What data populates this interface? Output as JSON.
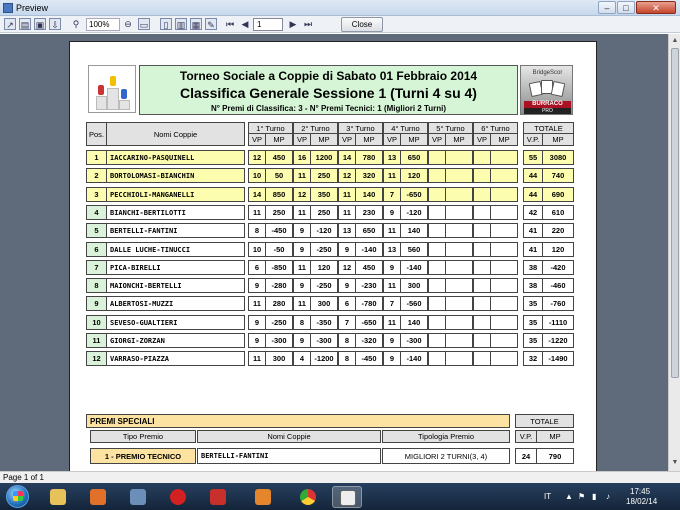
{
  "window": {
    "title": "Preview",
    "minimize": "–",
    "maximize": "□",
    "close": "✕"
  },
  "toolbar": {
    "zoom": "100%",
    "page": "1",
    "close_label": "Close"
  },
  "status": {
    "page_info": "Page 1 of 1"
  },
  "tray": {
    "lang": "IT",
    "time": "17:45",
    "date": "18/02/14"
  },
  "report": {
    "title": "Torneo Sociale a Coppie di Sabato 01 Febbraio 2014",
    "subtitle": "Classifica Generale Sessione 1 (Turni 4 su 4)",
    "info": "N° Premi di Classifica: 3  -  N° Premi Tecnici: 1 (Migliori 2 Turni)",
    "logo_brand": "BURRACO",
    "logo_sub": "PRO",
    "logo_top": "BridgeScor",
    "col_pos": "Pos.",
    "col_names": "Nomi Coppie",
    "turns": [
      "1° Turno",
      "2° Turno",
      "3° Turno",
      "4° Turno",
      "5° Turno",
      "6° Turno"
    ],
    "col_totale": "TOTALE",
    "sub_vp": "VP",
    "sub_mp": "MP",
    "sub_tvp": "V.P.",
    "sub_tmp": "MP",
    "rows": [
      {
        "pos": "1",
        "name": "IACCARINO-PASQUINELL",
        "t": [
          [
            "12",
            "450"
          ],
          [
            "16",
            "1200"
          ],
          [
            "14",
            "780"
          ],
          [
            "13",
            "650"
          ]
        ],
        "vp": "55",
        "mp": "3080",
        "hl": true
      },
      {
        "pos": "2",
        "name": "BORTOLOMASI-BIANCHIN",
        "t": [
          [
            "10",
            "50"
          ],
          [
            "11",
            "250"
          ],
          [
            "12",
            "320"
          ],
          [
            "11",
            "120"
          ]
        ],
        "vp": "44",
        "mp": "740",
        "hl": true
      },
      {
        "pos": "3",
        "name": "PECCHIOLI-MANGANELLI",
        "t": [
          [
            "14",
            "850"
          ],
          [
            "12",
            "350"
          ],
          [
            "11",
            "140"
          ],
          [
            "7",
            "-650"
          ]
        ],
        "vp": "44",
        "mp": "690",
        "hl": true
      },
      {
        "pos": "4",
        "name": "BIANCHI-BERTILOTTI",
        "t": [
          [
            "11",
            "250"
          ],
          [
            "11",
            "250"
          ],
          [
            "11",
            "230"
          ],
          [
            "9",
            "-120"
          ]
        ],
        "vp": "42",
        "mp": "610",
        "hl": false
      },
      {
        "pos": "5",
        "name": "BERTELLI-FANTINI",
        "t": [
          [
            "8",
            "-450"
          ],
          [
            "9",
            "-120"
          ],
          [
            "13",
            "650"
          ],
          [
            "11",
            "140"
          ]
        ],
        "vp": "41",
        "mp": "220",
        "hl": false
      },
      {
        "pos": "6",
        "name": "DALLE LUCHE-TINUCCI",
        "t": [
          [
            "10",
            "-50"
          ],
          [
            "9",
            "-250"
          ],
          [
            "9",
            "-140"
          ],
          [
            "13",
            "560"
          ]
        ],
        "vp": "41",
        "mp": "120",
        "hl": false
      },
      {
        "pos": "7",
        "name": "PICA-BIRELLI",
        "t": [
          [
            "6",
            "-850"
          ],
          [
            "11",
            "120"
          ],
          [
            "12",
            "450"
          ],
          [
            "9",
            "-140"
          ]
        ],
        "vp": "38",
        "mp": "-420",
        "hl": false
      },
      {
        "pos": "8",
        "name": "MAIONCHI-BERTELLI",
        "t": [
          [
            "9",
            "-280"
          ],
          [
            "9",
            "-250"
          ],
          [
            "9",
            "-230"
          ],
          [
            "11",
            "300"
          ]
        ],
        "vp": "38",
        "mp": "-460",
        "hl": false
      },
      {
        "pos": "9",
        "name": "ALBERTOSI-MUZZI",
        "t": [
          [
            "11",
            "280"
          ],
          [
            "11",
            "300"
          ],
          [
            "6",
            "-780"
          ],
          [
            "7",
            "-560"
          ]
        ],
        "vp": "35",
        "mp": "-760",
        "hl": false
      },
      {
        "pos": "10",
        "name": "SEVESO-GUALTIERI",
        "t": [
          [
            "9",
            "-250"
          ],
          [
            "8",
            "-350"
          ],
          [
            "7",
            "-650"
          ],
          [
            "11",
            "140"
          ]
        ],
        "vp": "35",
        "mp": "-1110",
        "hl": false
      },
      {
        "pos": "11",
        "name": "GIORGI-ZORZAN",
        "t": [
          [
            "9",
            "-300"
          ],
          [
            "9",
            "-300"
          ],
          [
            "8",
            "-320"
          ],
          [
            "9",
            "-300"
          ]
        ],
        "vp": "35",
        "mp": "-1220",
        "hl": false
      },
      {
        "pos": "12",
        "name": "VARRASO-PIAZZA",
        "t": [
          [
            "11",
            "300"
          ],
          [
            "4",
            "-1200"
          ],
          [
            "8",
            "-450"
          ],
          [
            "9",
            "-140"
          ]
        ],
        "vp": "32",
        "mp": "-1490",
        "hl": false
      }
    ],
    "premi": {
      "title": "PREMI SPECIALI",
      "col_tipo": "Tipo Premio",
      "col_nomi": "Nomi Coppie",
      "col_tipologia": "Tipologia Premio",
      "col_totale": "TOTALE",
      "sub_vp": "V.P.",
      "sub_mp": "MP",
      "tipo": "1 - PREMIO TECNICO",
      "nomi": "BERTELLI-FANTINI",
      "tipologia": "MIGLIORI 2 TURNI(3, 4)",
      "vp": "24",
      "mp": "790"
    }
  }
}
